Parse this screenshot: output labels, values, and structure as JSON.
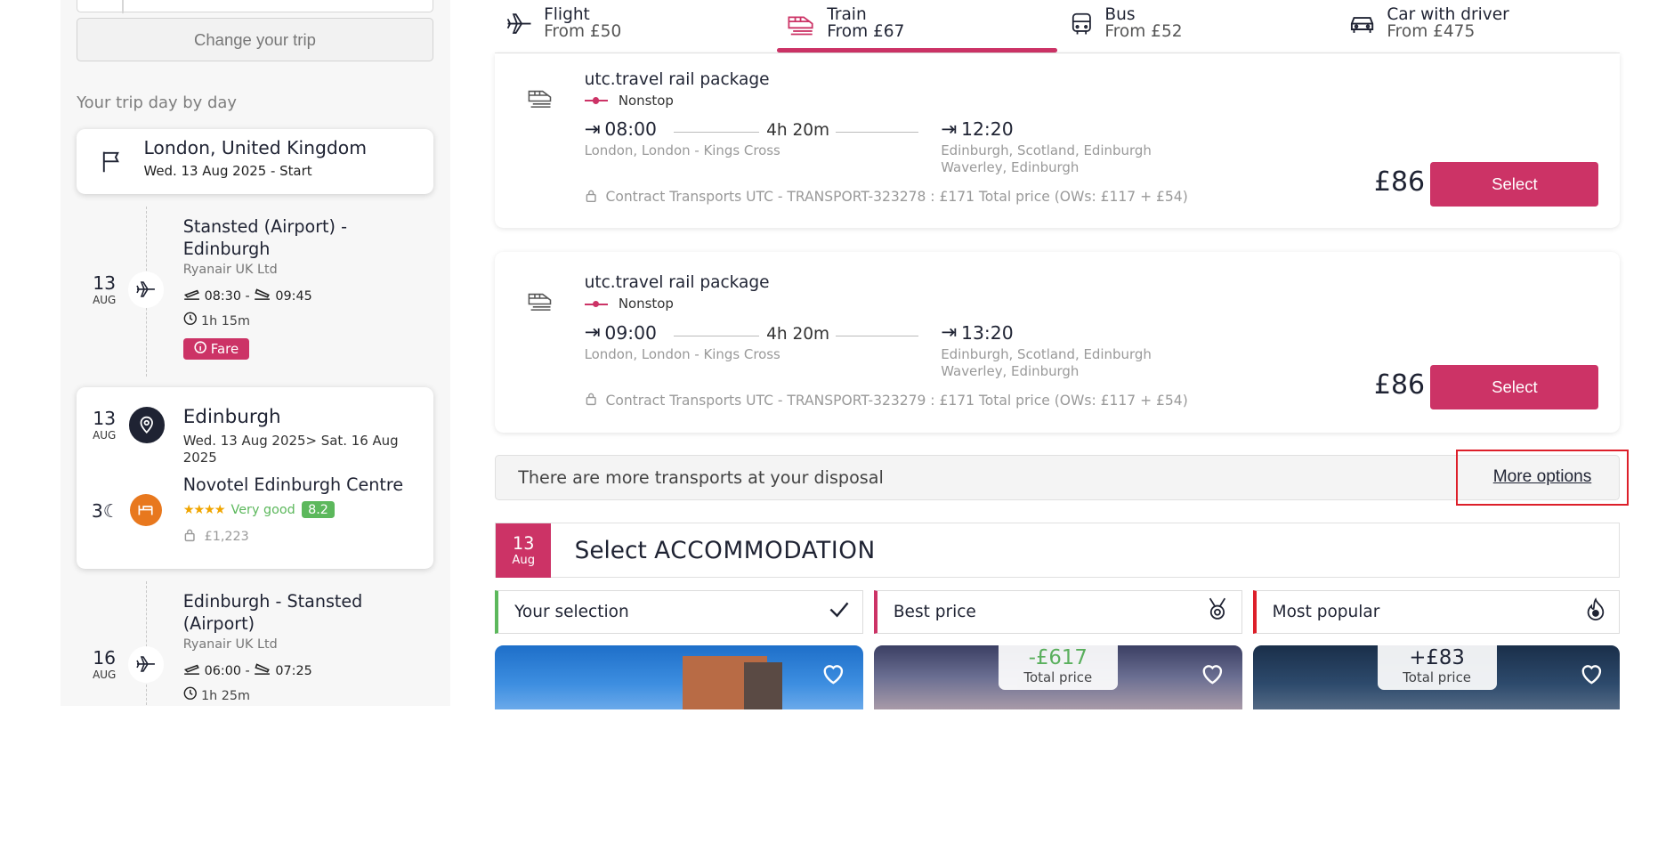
{
  "sidebar": {
    "change_trip": "Change your trip",
    "section_title": "Your trip day by day",
    "start": {
      "city": "London, United Kingdom",
      "date": "Wed. 13 Aug 2025 - Start"
    },
    "flight_out": {
      "day": "13",
      "month": "AUG",
      "route": "Stansted (Airport) - Edinburgh",
      "carrier": "Ryanair UK Ltd",
      "times": "08:30 - ",
      "arrive": "09:45",
      "duration": "1h 15m",
      "fare": "Fare"
    },
    "stay": {
      "day": "13",
      "month": "AUG",
      "city": "Edinburgh",
      "dates": "Wed. 13 Aug 2025> Sat. 16 Aug 2025",
      "nights": "3",
      "hotel": "Novotel Edinburgh Centre",
      "stars": "★★★★",
      "rating_text": "Very good",
      "score": "8.2",
      "price": "£1,223"
    },
    "flight_back": {
      "day": "16",
      "month": "AUG",
      "route": "Edinburgh - Stansted (Airport)",
      "carrier": "Ryanair UK Ltd",
      "times": "06:00 - ",
      "arrive": "07:25",
      "duration": "1h 25m"
    }
  },
  "tabs": [
    {
      "label": "Flight",
      "from": "From £50",
      "icon": "plane-icon"
    },
    {
      "label": "Train",
      "from": "From £67",
      "icon": "train-icon"
    },
    {
      "label": "Bus",
      "from": "From £52",
      "icon": "bus-icon"
    },
    {
      "label": "Car with driver",
      "from": "From £475",
      "icon": "car-icon"
    }
  ],
  "offers": [
    {
      "title": "utc.travel rail package",
      "stops": "Nonstop",
      "depart": "08:00",
      "depart_station": "London, London - Kings Cross",
      "duration": "4h 20m",
      "arrive": "12:20",
      "arrive_station_1": "Edinburgh, Scotland, Edinburgh",
      "arrive_station_2": "Waverley, Edinburgh",
      "contract": "Contract Transports UTC - TRANSPORT-323278 : £171 Total price (OWs: £117 + £54)",
      "price": "£86",
      "select": "Select"
    },
    {
      "title": "utc.travel rail package",
      "stops": "Nonstop",
      "depart": "09:00",
      "depart_station": "London, London - Kings Cross",
      "duration": "4h 20m",
      "arrive": "13:20",
      "arrive_station_1": "Edinburgh, Scotland, Edinburgh",
      "arrive_station_2": "Waverley, Edinburgh",
      "contract": "Contract Transports UTC - TRANSPORT-323279 : £171 Total price (OWs: £117 + £54)",
      "price": "£86",
      "select": "Select"
    }
  ],
  "more": {
    "text": "There are more transports at your disposal",
    "button": "More options"
  },
  "accommodation": {
    "day": "13",
    "month": "Aug",
    "title_prefix": "Select",
    "title_main": "ACCOMMODATION",
    "filters": [
      {
        "label": "Your selection",
        "icon": "check-icon"
      },
      {
        "label": "Best price",
        "icon": "medal-icon"
      },
      {
        "label": "Most popular",
        "icon": "flame-icon"
      }
    ],
    "hotels": [
      {
        "delta": "",
        "delta_label": ""
      },
      {
        "delta": "-£617",
        "delta_label": "Total price"
      },
      {
        "delta": "+£83",
        "delta_label": "Total price"
      }
    ]
  },
  "colors": {
    "accent": "#cc3366",
    "highlight_border": "#dd1f2a",
    "good_green": "#5cb85c",
    "navy": "#1f2333"
  }
}
